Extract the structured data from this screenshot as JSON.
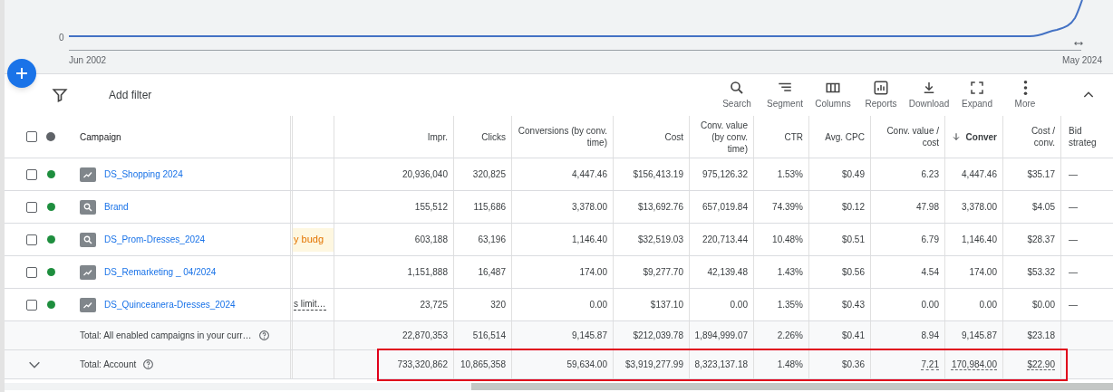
{
  "chart": {
    "y_tick": "0",
    "x_start": "Jun 2002",
    "x_end": "May 2024"
  },
  "toolbar": {
    "filter_label": "Add filter",
    "actions": [
      {
        "label": "Search",
        "kind": "search"
      },
      {
        "label": "Segment",
        "kind": "segment"
      },
      {
        "label": "Columns",
        "kind": "columns"
      },
      {
        "label": "Reports",
        "kind": "reports"
      },
      {
        "label": "Download",
        "kind": "download"
      },
      {
        "label": "Expand",
        "kind": "expand"
      },
      {
        "label": "More",
        "kind": "more"
      }
    ],
    "collapsed": false
  },
  "table": {
    "header": {
      "checked": false,
      "campaign": "Campaign",
      "columns": [
        {
          "label": "Impr.",
          "sorted": false
        },
        {
          "label": "Clicks",
          "sorted": false
        },
        {
          "label": "Conversions (by conv. time)",
          "sorted": false
        },
        {
          "label": "Cost",
          "sorted": false
        },
        {
          "label": "Conv. value (by conv. time)",
          "sorted": false
        },
        {
          "label": "CTR",
          "sorted": false
        },
        {
          "label": "Avg. CPC",
          "sorted": false
        },
        {
          "label": "Conv. value / cost",
          "sorted": false
        },
        {
          "label": "Conver",
          "sorted": true
        },
        {
          "label": "Cost / conv.",
          "sorted": false
        },
        {
          "label": "Bid strateg",
          "sorted": false
        }
      ]
    },
    "rows": [
      {
        "name": "DS_Shopping 2024",
        "kind": "trend",
        "checked": false,
        "color": "#1e8e3e",
        "values": [
          "20,936,040",
          "320,825",
          "4,447.46",
          "$156,413.19",
          "975,126.32",
          "1.53%",
          "$0.49",
          "6.23",
          "4,447.46",
          "$35.17",
          "—"
        ]
      },
      {
        "name": "Brand",
        "kind": "search",
        "checked": false,
        "color": "#1e8e3e",
        "values": [
          "155,512",
          "115,686",
          "3,378.00",
          "$13,692.76",
          "657,019.84",
          "74.39%",
          "$0.12",
          "47.98",
          "3,378.00",
          "$4.05",
          "—"
        ]
      },
      {
        "name": "DS_Prom-Dresses_2024",
        "kind": "search",
        "checked": false,
        "color": "#1e8e3e",
        "note": {
          "text": "y budg",
          "kind": "warning"
        },
        "values": [
          "603,188",
          "63,196",
          "1,146.40",
          "$32,519.03",
          "220,713.44",
          "10.48%",
          "$0.51",
          "6.79",
          "1,146.40",
          "$28.37",
          "—"
        ]
      },
      {
        "name": "DS_Remarketing _ 04/2024",
        "kind": "trend",
        "checked": false,
        "color": "#1e8e3e",
        "values": [
          "1,151,888",
          "16,487",
          "174.00",
          "$9,277.70",
          "42,139.48",
          "1.43%",
          "$0.56",
          "4.54",
          "174.00",
          "$53.32",
          "—"
        ]
      },
      {
        "name": "DS_Quinceanera-Dresses_2024",
        "kind": "trend",
        "checked": false,
        "color": "#1e8e3e",
        "note": {
          "text": "s limit…",
          "kind": "tooltip"
        },
        "values": [
          "23,725",
          "320",
          "0.00",
          "$137.10",
          "0.00",
          "1.35%",
          "$0.43",
          "0.00",
          "0.00",
          "$0.00",
          "—"
        ]
      }
    ],
    "totals": [
      {
        "label": "Total: All enabled campaigns in your curr…",
        "expandable": false,
        "highlighted": false,
        "values": [
          "22,870,353",
          "516,514",
          "9,145.87",
          "$212,039.78",
          "1,894,999.07",
          "2.26%",
          "$0.41",
          "8.94",
          "9,145.87",
          "$23.18"
        ]
      },
      {
        "label": "Total: Account",
        "expandable": true,
        "highlighted": true,
        "values": [
          "733,320,862",
          "10,865,358",
          "59,634.00",
          "$3,919,277.99",
          "8,323,137.18",
          "1.48%",
          "$0.36",
          {
            "text": "7.21",
            "underlined": true
          },
          {
            "text": "170,984.00",
            "underlined": true
          },
          {
            "text": "$22.90",
            "underlined": true
          }
        ]
      }
    ]
  }
}
